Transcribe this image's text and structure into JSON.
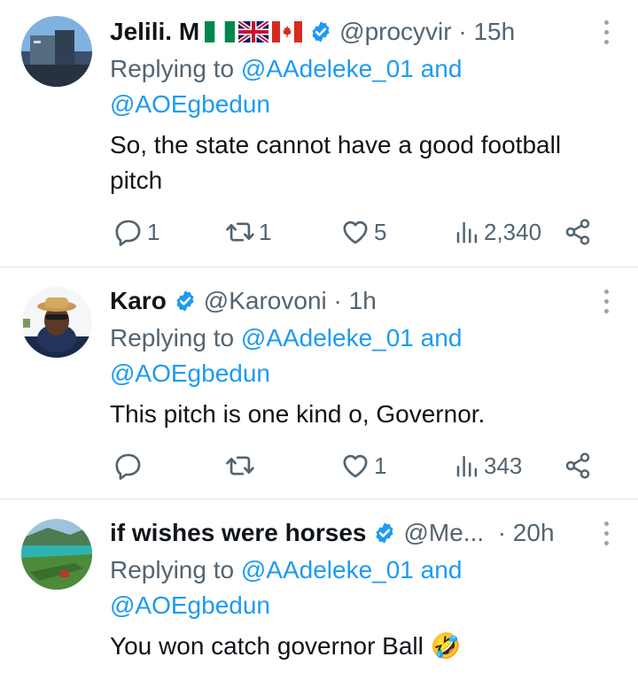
{
  "tweets": [
    {
      "name": "Jelili. M",
      "flags": [
        "nigeria-flag",
        "uk-flag",
        "canada-flag"
      ],
      "handle": "@procyvir",
      "time": "· 15h",
      "replying_prefix": "Replying to",
      "mention1": "@AAdeleke_01",
      "and_word": "and",
      "mention2": "@AOEgbedun",
      "text_line1": "So, the state cannot have a good football",
      "text_line2": "pitch",
      "replies": "1",
      "retweets": "1",
      "likes": "5",
      "views": "2,340"
    },
    {
      "name": "Karo",
      "handle": "@Karovoni",
      "time": "· 1h",
      "replying_prefix": "Replying to",
      "mention1": "@AAdeleke_01",
      "and_word": "and",
      "mention2": "@AOEgbedun",
      "text_line1": "This pitch is one kind o, Governor.",
      "replies": "",
      "retweets": "",
      "likes": "1",
      "views": "343"
    },
    {
      "name": "if wishes were horses",
      "handle": "@Me...",
      "time": "· 20h",
      "replying_prefix": "Replying to",
      "mention1": "@AAdeleke_01",
      "and_word": "and",
      "mention2": "@AOEgbedun",
      "text_line1": "You won catch governor Ball 🤣"
    }
  ],
  "icons": {
    "reply": "reply-icon",
    "retweet": "retweet-icon",
    "like": "heart-icon",
    "views": "views-chart-icon",
    "share": "share-icon",
    "verified": "verified-badge-icon",
    "more": "more-options-icon"
  },
  "colors": {
    "text": "#0f1419",
    "secondary": "#536471",
    "link": "#1d9bf0",
    "verified": "#1d9bf0",
    "divider": "#e3e6e8"
  }
}
